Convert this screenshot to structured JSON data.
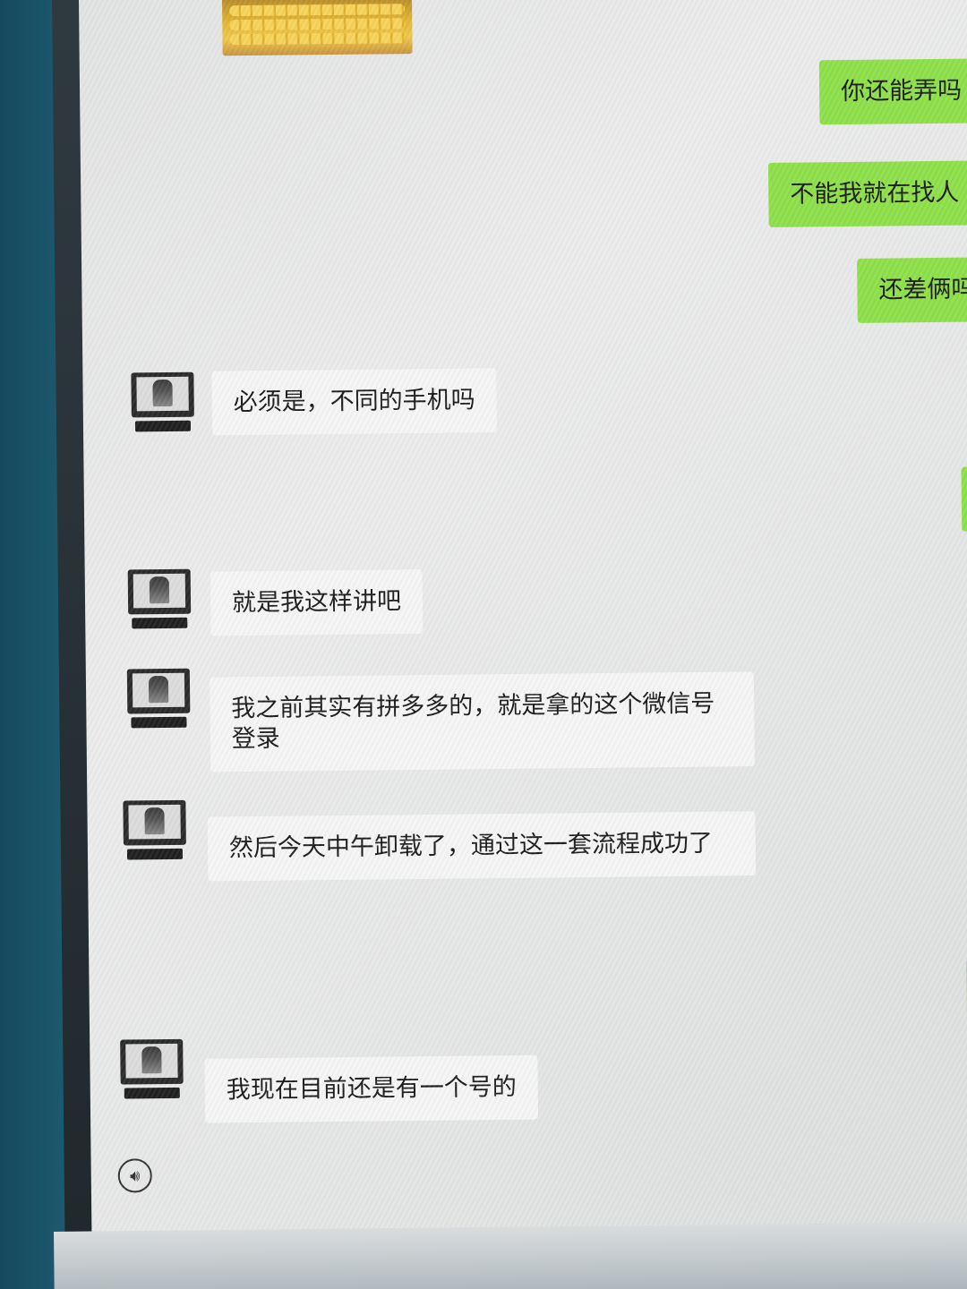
{
  "chat": {
    "sent_messages": [
      {
        "text": "你还能弄吗"
      },
      {
        "text": "不能我就在找人"
      },
      {
        "text": "还差俩吗"
      }
    ],
    "received_messages": [
      {
        "text": "必须是，不同的手机吗"
      },
      {
        "text": "就是我这样讲吧"
      },
      {
        "text": "我之前其实有拼多多的，就是拿的这个微信号登录"
      },
      {
        "text": "然后今天中午卸载了，通过这一套流程成功了"
      },
      {
        "text": "我现在目前还是有一个号的"
      }
    ]
  },
  "input_bar": {
    "voice_icon": "voice-input-icon"
  },
  "colors": {
    "sent_bubble": "#8ee04a",
    "received_bubble": "#f5f5f5",
    "chat_background": "#e8e8e8"
  }
}
